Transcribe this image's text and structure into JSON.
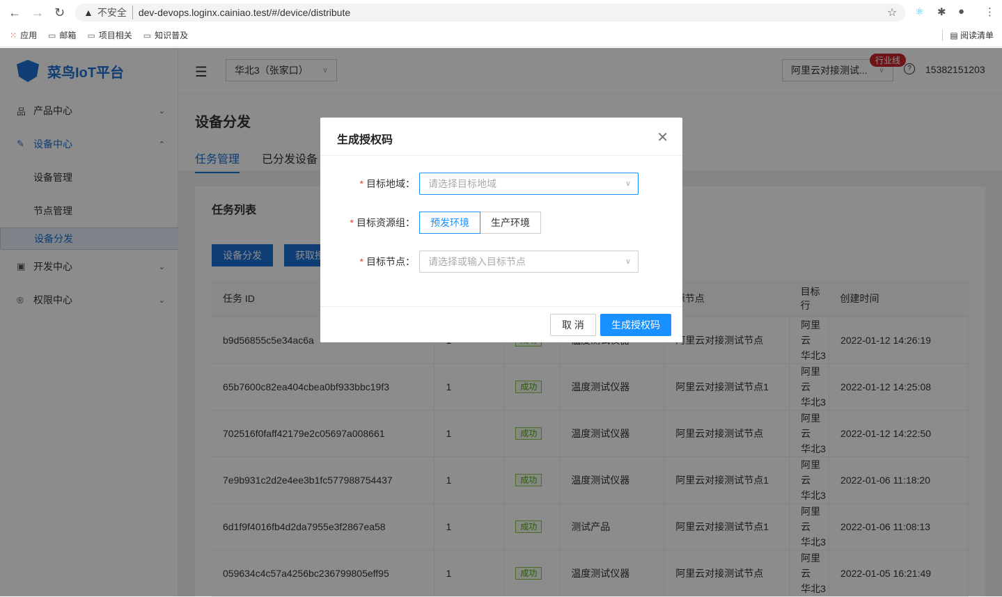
{
  "browser": {
    "insecure": "不安全",
    "url": "dev-devops.loginx.cainiao.test/#/device/distribute",
    "bookmarks": [
      "应用",
      "邮箱",
      "项目相关",
      "知识普及"
    ],
    "reading_list": "阅读清单"
  },
  "app": {
    "logo": "菜鸟IoT平台",
    "region": "华北3（张家口）",
    "project": "阿里云对接测试...",
    "project_badge": "行业线",
    "phone": "15382151203"
  },
  "sidebar": {
    "items": [
      {
        "label": "产品中心",
        "icon": "product-icon"
      },
      {
        "label": "设备中心",
        "icon": "wrench-icon"
      },
      {
        "label": "设备管理"
      },
      {
        "label": "节点管理"
      },
      {
        "label": "设备分发"
      },
      {
        "label": "开发中心",
        "icon": "terminal-icon"
      },
      {
        "label": "权限中心",
        "icon": "registered-icon"
      }
    ]
  },
  "page": {
    "title": "设备分发",
    "tabs": [
      "任务管理",
      "已分发设备"
    ],
    "card_title": "任务列表",
    "buttons": [
      "设备分发",
      "获取授权码"
    ]
  },
  "table": {
    "headers": [
      "任务 ID",
      "",
      "",
      "",
      "源节点",
      "目标行",
      "创建时间"
    ],
    "rows": [
      [
        "b9d56855c5e34ac6a",
        "1",
        "成功",
        "温度测试仪器",
        "阿里云对接测试节点",
        "阿里云\n华北3",
        "2022-01-12 14:26:19"
      ],
      [
        "65b7600c82ea404cbea0bf933bbc19f3",
        "1",
        "成功",
        "温度测试仪器",
        "阿里云对接测试节点1",
        "阿里云\n华北3",
        "2022-01-12 14:25:08"
      ],
      [
        "702516f0faff42179e2c05697a008661",
        "1",
        "成功",
        "温度测试仪器",
        "阿里云对接测试节点",
        "阿里云\n华北3",
        "2022-01-12 14:22:50"
      ],
      [
        "7e9b931c2d2e4ee3b1fc577988754437",
        "1",
        "成功",
        "温度测试仪器",
        "阿里云对接测试节点1",
        "阿里云\n华北3",
        "2022-01-06 11:18:20"
      ],
      [
        "6d1f9f4016fb4d2da7955e3f2867ea58",
        "1",
        "成功",
        "测试产品",
        "阿里云对接测试节点1",
        "阿里云\n华北3",
        "2022-01-06 11:08:13"
      ],
      [
        "059634c4c57a4256bc236799805eff95",
        "1",
        "成功",
        "温度测试仪器",
        "阿里云对接测试节点",
        "阿里云\n华北3",
        "2022-01-05 16:21:49"
      ]
    ]
  },
  "modal": {
    "title": "生成授权码",
    "region_label": "目标地域：",
    "region_placeholder": "请选择目标地域",
    "group_label": "目标资源组：",
    "group_options": [
      "预发环境",
      "生产环境"
    ],
    "node_label": "目标节点：",
    "node_placeholder": "请选择或输入目标节点",
    "cancel": "取 消",
    "confirm": "生成授权码"
  }
}
